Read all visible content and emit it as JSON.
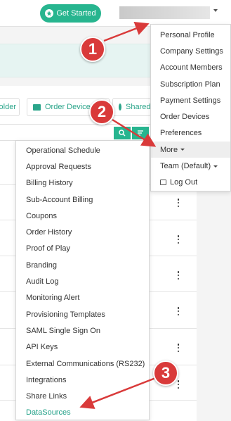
{
  "header": {
    "get_started_label": "Get Started",
    "user_name": ""
  },
  "toolbar": {
    "folder_label": "older",
    "order_devices_label": "Order Device",
    "shared_label": "Shared"
  },
  "user_menu": {
    "items": [
      {
        "label": "Personal Profile"
      },
      {
        "label": "Company Settings"
      },
      {
        "label": "Account Members"
      },
      {
        "label": "Subscription Plan"
      },
      {
        "label": "Payment Settings"
      },
      {
        "label": "Order Devices"
      },
      {
        "label": "Preferences"
      },
      {
        "label": "More"
      },
      {
        "label": "Team (Default)"
      },
      {
        "label": "Log Out"
      }
    ]
  },
  "more_menu": {
    "items": [
      {
        "label": "Operational Schedule"
      },
      {
        "label": "Approval Requests"
      },
      {
        "label": "Billing History"
      },
      {
        "label": "Sub-Account Billing"
      },
      {
        "label": "Coupons"
      },
      {
        "label": "Order History"
      },
      {
        "label": "Proof of Play"
      },
      {
        "label": "Branding"
      },
      {
        "label": "Audit Log"
      },
      {
        "label": "Monitoring Alert"
      },
      {
        "label": "Provisioning Templates"
      },
      {
        "label": "SAML Single Sign On"
      },
      {
        "label": "API Keys"
      },
      {
        "label": "External Communications (RS232)"
      },
      {
        "label": "Integrations"
      },
      {
        "label": "Share Links"
      },
      {
        "label": "DataSources"
      }
    ]
  },
  "callouts": [
    "1",
    "2",
    "3"
  ],
  "colors": {
    "accent": "#27b58f",
    "callout": "#d93a3a",
    "link": "#1f9f86"
  }
}
